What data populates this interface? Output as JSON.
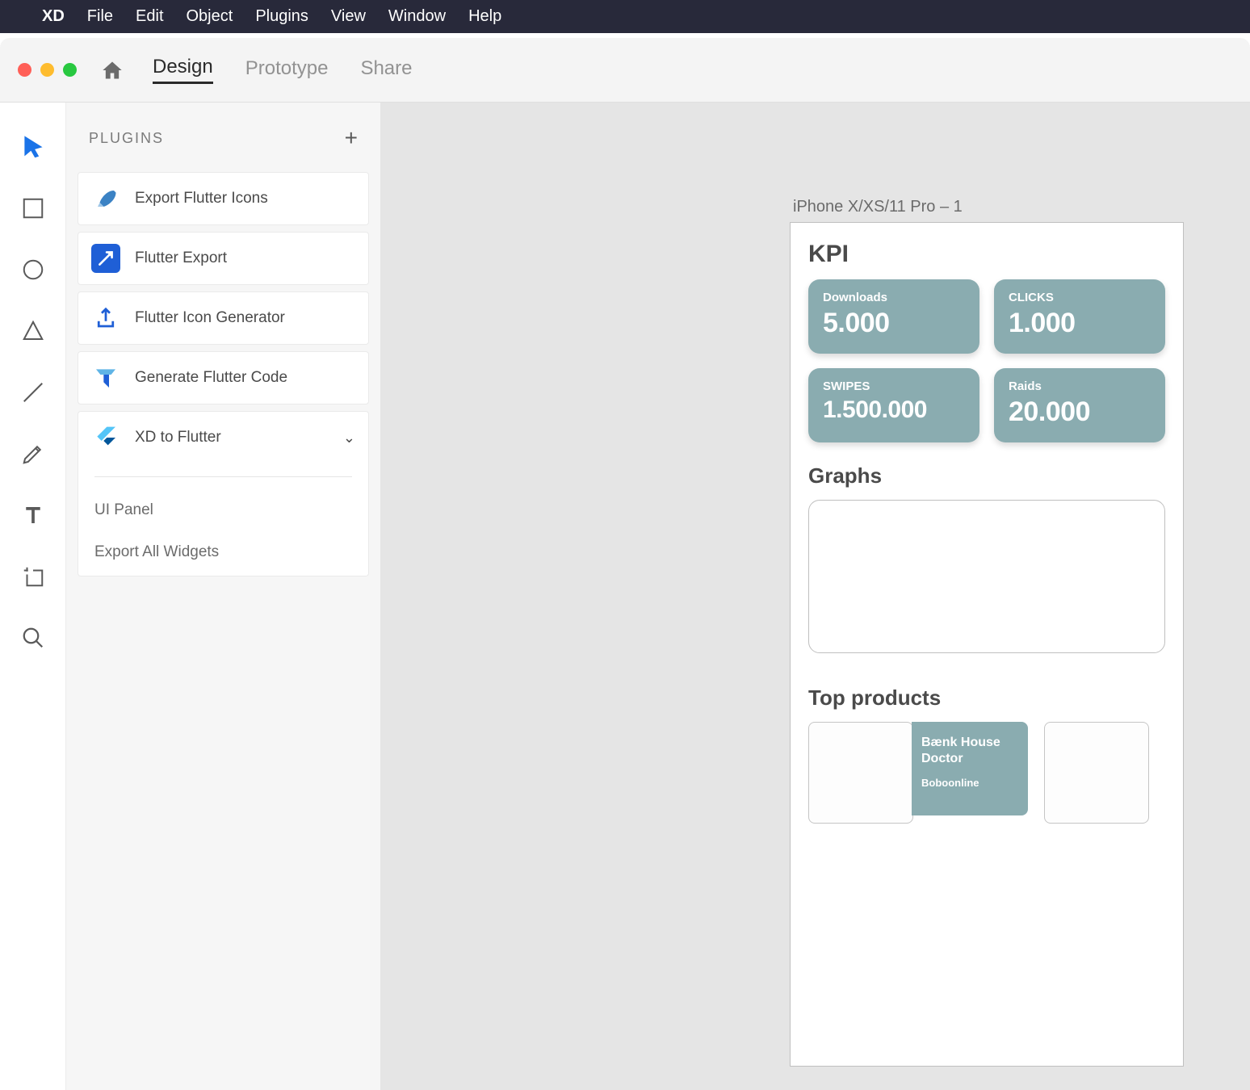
{
  "menubar": {
    "app": "XD",
    "items": [
      "File",
      "Edit",
      "Object",
      "Plugins",
      "View",
      "Window",
      "Help"
    ]
  },
  "tabs": {
    "design": "Design",
    "prototype": "Prototype",
    "share": "Share"
  },
  "plugins_panel": {
    "title": "PLUGINS",
    "items": [
      {
        "label": "Export Flutter Icons",
        "icon": "flutter-feather"
      },
      {
        "label": "Flutter Export",
        "icon": "export-arrow"
      },
      {
        "label": "Flutter Icon Generator",
        "icon": "upload"
      },
      {
        "label": "Generate Flutter Code",
        "icon": "flutter-t"
      },
      {
        "label": "XD to Flutter",
        "icon": "flutter",
        "expanded": true
      }
    ],
    "sub_items": [
      "UI Panel",
      "Export All Widgets"
    ]
  },
  "canvas": {
    "artboard_label": "iPhone X/XS/11 Pro – 1",
    "kpi_heading": "KPI",
    "kpis": [
      {
        "label": "Downloads",
        "value": "5.000"
      },
      {
        "label": "CLICKS",
        "value": "1.000"
      },
      {
        "label": "SWIPES",
        "value": "1.500.000"
      },
      {
        "label": "Raids",
        "value": "20.000"
      }
    ],
    "graphs_heading": "Graphs",
    "products_heading": "Top products",
    "product": {
      "title": "Bænk House Doctor",
      "vendor": "Boboonline"
    }
  }
}
